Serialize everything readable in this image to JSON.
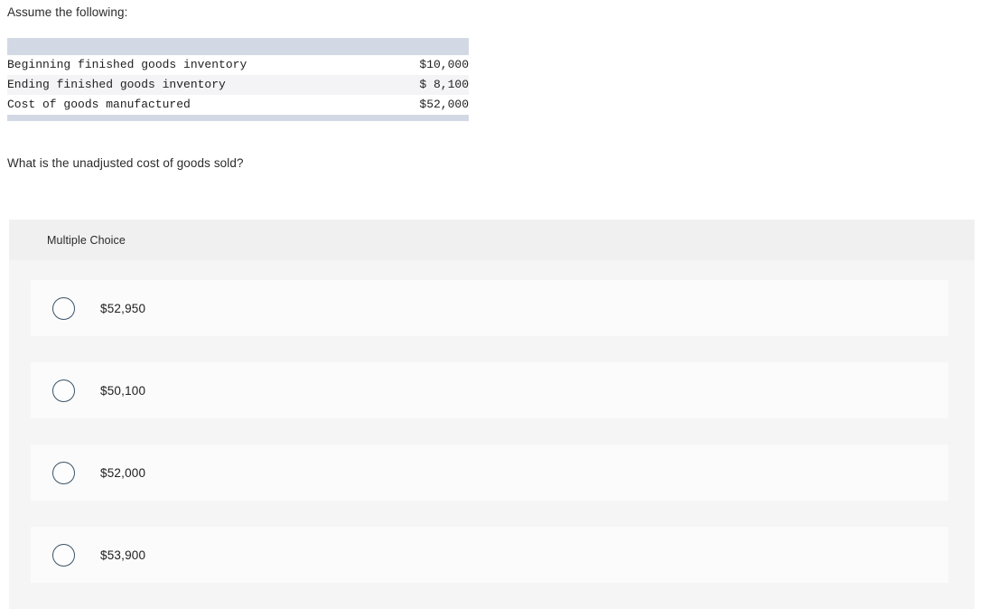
{
  "question": {
    "intro": "Assume the following:",
    "prompt": "What is the unadjusted cost of goods sold?"
  },
  "table": {
    "header_label": "",
    "rows": [
      {
        "label": "Beginning finished goods inventory",
        "value": "$10,000"
      },
      {
        "label": "Ending finished goods inventory",
        "value": "$ 8,100"
      },
      {
        "label": "Cost of goods manufactured",
        "value": "$52,000"
      }
    ]
  },
  "multiple_choice": {
    "section_label": "Multiple Choice",
    "options": [
      {
        "label": "$52,950",
        "selected": false
      },
      {
        "label": "$50,100",
        "selected": false
      },
      {
        "label": "$52,000",
        "selected": false
      },
      {
        "label": "$53,900",
        "selected": false
      }
    ]
  },
  "colors": {
    "table_header_band": "#d3d9e4",
    "table_alt_row": "#f4f4f6",
    "panel_background": "#f5f5f5",
    "panel_header": "#f0f0f0",
    "option_card": "#fbfbfb",
    "radio_border": "#3b5368",
    "page_background": "#ffffff"
  }
}
